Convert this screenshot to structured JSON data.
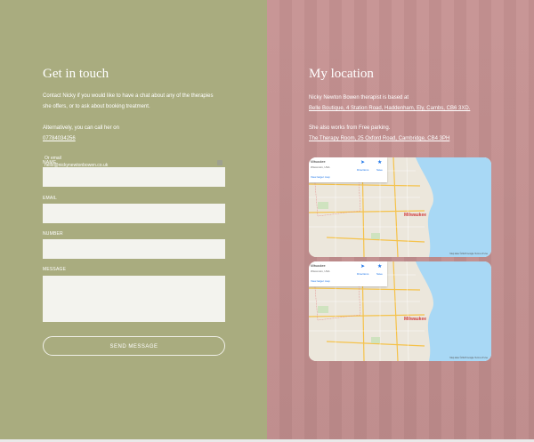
{
  "contact": {
    "heading": "Get in touch",
    "intro_line1": "Contact Nicky if you would like to have a chat about any of the therapies",
    "intro_line2": "she offers, or to ask about booking treatment.",
    "call_text": "Alternatively, you can call her on",
    "phone": "07784034256",
    "email_label": "Or email",
    "email_value": "hello@nickynewtonbowen.co.uk",
    "name_label": "NAME",
    "email_field_label": "EMAIL",
    "number_label": "NUMBER",
    "message_label": "MESSAGE",
    "send_label": "SEND MESSAGE"
  },
  "location": {
    "heading": "My location",
    "line1": "Nicky Newton Bowen therapist is based at",
    "address1": "Belle Boutique, 4 Station Road, Haddenham, Ely, Cambs, CB6 3XD.",
    "line2": "She also works from",
    "line2b": "Free parking.",
    "address2": "The Therapy Room, 25 Oxford Road, Cambridge, CB4 3PH",
    "maps": [
      {
        "place": "Milwaukee",
        "region": "Wisconsin, USA",
        "directions": "Directions",
        "save": "Save",
        "bigger": "View larger map",
        "city_label": "Milwaukee",
        "attribution": "Map data ©2023 Google  Terms of Use"
      },
      {
        "place": "Milwaukee",
        "region": "Wisconsin, USA",
        "directions": "Directions",
        "save": "Save",
        "bigger": "View larger map",
        "city_label": "Milwaukee",
        "attribution": "Map data ©2023 Google  Terms of Use"
      }
    ]
  },
  "colors": {
    "left_panel": "#a9ac7f",
    "right_panel": "#c48f8f",
    "field_bg": "#f3f3ee",
    "lake": "#a8d8f5"
  }
}
